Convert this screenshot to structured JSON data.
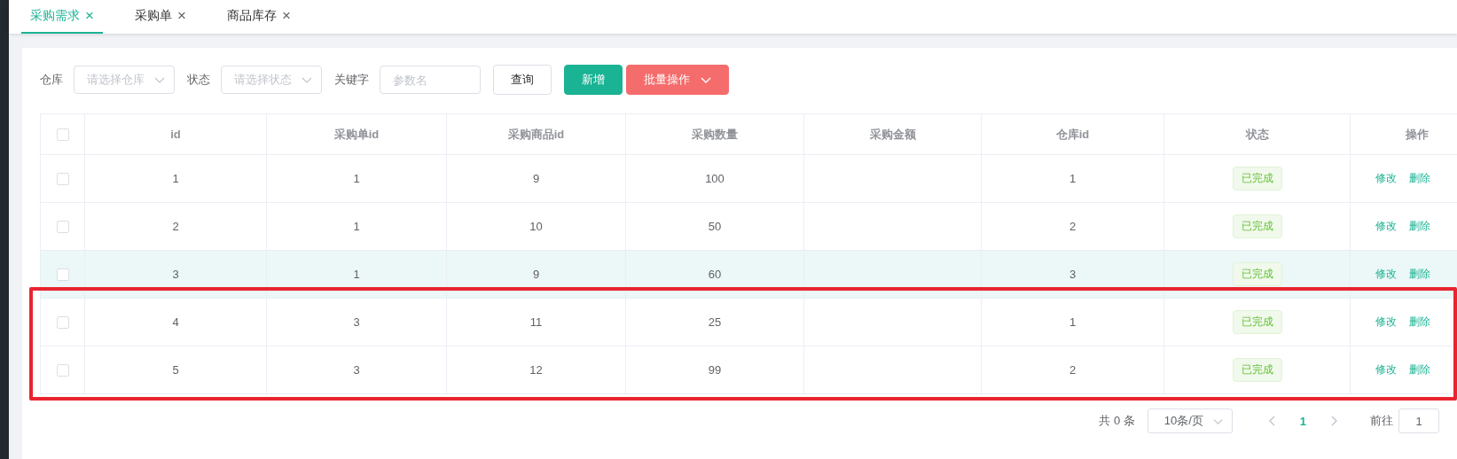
{
  "tabs": [
    {
      "label": "采购需求",
      "close": "×",
      "selected": true
    },
    {
      "label": "采购单",
      "close": "×",
      "selected": false
    },
    {
      "label": "商品库存",
      "close": "×",
      "selected": false
    }
  ],
  "filters": [
    {
      "kind": "select",
      "label": "仓库",
      "placeholder": "请选择仓库"
    },
    {
      "kind": "select",
      "label": "状态",
      "placeholder": "请选择状态"
    },
    {
      "kind": "input",
      "label": "关键字",
      "placeholder": "参数名"
    }
  ],
  "buttons": [
    {
      "kind": "plain",
      "label": "查询"
    },
    {
      "kind": "primary",
      "label": "新增"
    },
    {
      "kind": "danger",
      "label": "批量操作"
    }
  ],
  "table": {
    "columns": [
      "id",
      "采购单id",
      "采购商品id",
      "采购数量",
      "采购金额",
      "仓库id",
      "状态",
      "操作"
    ],
    "header_checked": false,
    "rows": [
      {
        "checked": false,
        "hovered": false,
        "boxed": false,
        "cells": [
          "1",
          "1",
          "9",
          "100",
          "",
          "1"
        ],
        "status": "已完成",
        "actions": [
          "修改",
          "删除"
        ]
      },
      {
        "checked": false,
        "hovered": false,
        "boxed": false,
        "cells": [
          "2",
          "1",
          "10",
          "50",
          "",
          "2"
        ],
        "status": "已完成",
        "actions": [
          "修改",
          "删除"
        ]
      },
      {
        "checked": false,
        "hovered": true,
        "boxed": false,
        "cells": [
          "3",
          "1",
          "9",
          "60",
          "",
          "3"
        ],
        "status": "已完成",
        "actions": [
          "修改",
          "删除"
        ]
      },
      {
        "checked": false,
        "hovered": false,
        "boxed": true,
        "cells": [
          "4",
          "3",
          "11",
          "25",
          "",
          "1"
        ],
        "status": "已完成",
        "actions": [
          "修改",
          "删除"
        ]
      },
      {
        "checked": false,
        "hovered": false,
        "boxed": true,
        "cells": [
          "5",
          "3",
          "12",
          "99",
          "",
          "2"
        ],
        "status": "已完成",
        "actions": [
          "修改",
          "删除"
        ]
      }
    ]
  },
  "pagination": {
    "total": "共 0 条",
    "page_size": "10条/页",
    "pages": [
      {
        "label": "1",
        "selected": true
      }
    ],
    "goto_label": "前往",
    "goto_value": "1"
  }
}
